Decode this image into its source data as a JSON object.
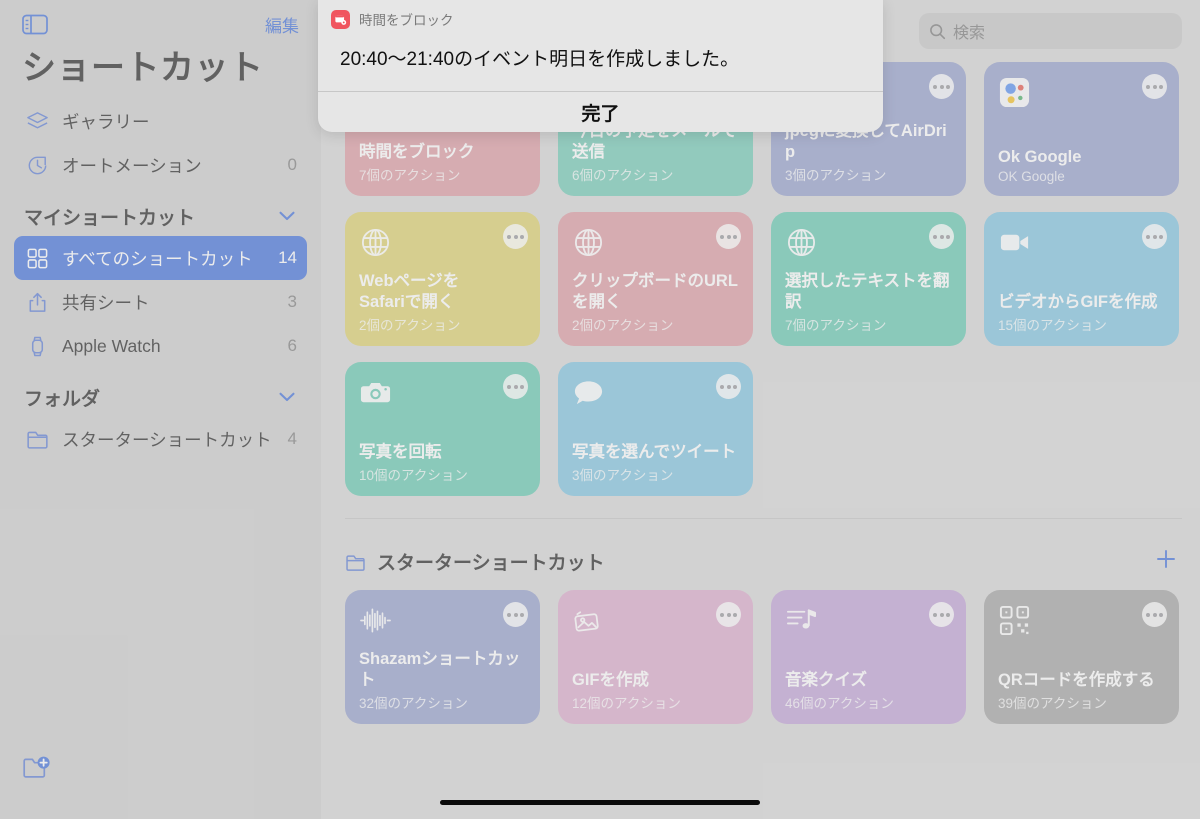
{
  "sidebar": {
    "toggle_icon": "sidebar-toggle-icon",
    "edit_label": "編集",
    "title": "ショートカット",
    "top_items": [
      {
        "icon": "gallery-layers-icon",
        "label": "ギャラリー",
        "count": ""
      },
      {
        "icon": "automation-clock-icon",
        "label": "オートメーション",
        "count": "0"
      }
    ],
    "my_shortcuts_group": {
      "label": "マイショートカット",
      "chevron": "chevron-down-icon"
    },
    "my_shortcuts_items": [
      {
        "icon": "grid-icon",
        "label": "すべてのショートカット",
        "count": "14",
        "selected": true
      },
      {
        "icon": "share-icon",
        "label": "共有シート",
        "count": "3",
        "selected": false
      },
      {
        "icon": "watch-icon",
        "label": "Apple Watch",
        "count": "6",
        "selected": false
      }
    ],
    "folders_group": {
      "label": "フォルダ",
      "chevron": "chevron-down-icon"
    },
    "folder_items": [
      {
        "icon": "folder-icon",
        "label": "スターターショートカット",
        "count": "4"
      }
    ],
    "new_folder_icon": "new-folder-icon"
  },
  "search": {
    "icon": "search-icon",
    "placeholder": "検索",
    "value": ""
  },
  "shortcuts": [
    {
      "title": "時間をブロック",
      "subtitle": "7個のアクション",
      "color": "#d9929a",
      "glyph": "calendar-plus-icon"
    },
    {
      "title": "今日の予定をメールで送信",
      "subtitle": "6個のアクション",
      "color": "#65c4ae",
      "glyph": "layers-icon"
    },
    {
      "title": "jpegに変換してAirDrip",
      "subtitle": "3個のアクション",
      "color": "#8b96c7",
      "glyph": "layers-icon"
    },
    {
      "title": "Ok Google",
      "subtitle": "OK Google",
      "color": "#8b96c7",
      "glyph": "google-assistant-icon"
    },
    {
      "title": "Webページを\nSafariで開く",
      "subtitle": "2個のアクション",
      "color": "#d9cc5f",
      "glyph": "globe-icon"
    },
    {
      "title": "クリップボードのURLを開く",
      "subtitle": "2個のアクション",
      "color": "#d9929a",
      "glyph": "globe-icon"
    },
    {
      "title": "選択したテキストを翻訳",
      "subtitle": "7個のアクション",
      "color": "#57c3a9",
      "glyph": "globe-icon"
    },
    {
      "title": "ビデオからGIFを作成",
      "subtitle": "15個のアクション",
      "color": "#74bedc",
      "glyph": "video-icon"
    },
    {
      "title": "写真を回転",
      "subtitle": "10個のアクション",
      "color": "#57c3a9",
      "glyph": "camera-icon"
    },
    {
      "title": "写真を選んでツイート",
      "subtitle": "3個のアクション",
      "color": "#74bedc",
      "glyph": "chat-bubble-icon"
    }
  ],
  "folder_section": {
    "icon": "folder-icon",
    "title": "スターターショートカット",
    "add_icon": "plus-icon",
    "shortcuts": [
      {
        "title": "Shazamショートカット",
        "subtitle": "32個のアクション",
        "color": "#8b96c7",
        "glyph": "waveform-icon"
      },
      {
        "title": "GIFを作成",
        "subtitle": "12個のアクション",
        "color": "#d8a3c6",
        "glyph": "photos-icon"
      },
      {
        "title": "音楽クイズ",
        "subtitle": "46個のアクション",
        "color": "#bb9ad2",
        "glyph": "music-list-icon"
      },
      {
        "title": "QRコードを作成する",
        "subtitle": "39個のアクション",
        "color": "#9a9a9a",
        "glyph": "qrcode-icon"
      }
    ]
  },
  "alert": {
    "app_icon": "block-time-app-icon",
    "app_name": "時間をブロック",
    "message": "20:40〜21:40のイベント明日を作成しました。",
    "button_label": "完了"
  },
  "colors": {
    "accent_blue": "#2f62d8",
    "sidebar_bg": "#c9c9c9",
    "main_bg": "#d3d3d3",
    "alert_bg": "#e6e6e6"
  }
}
